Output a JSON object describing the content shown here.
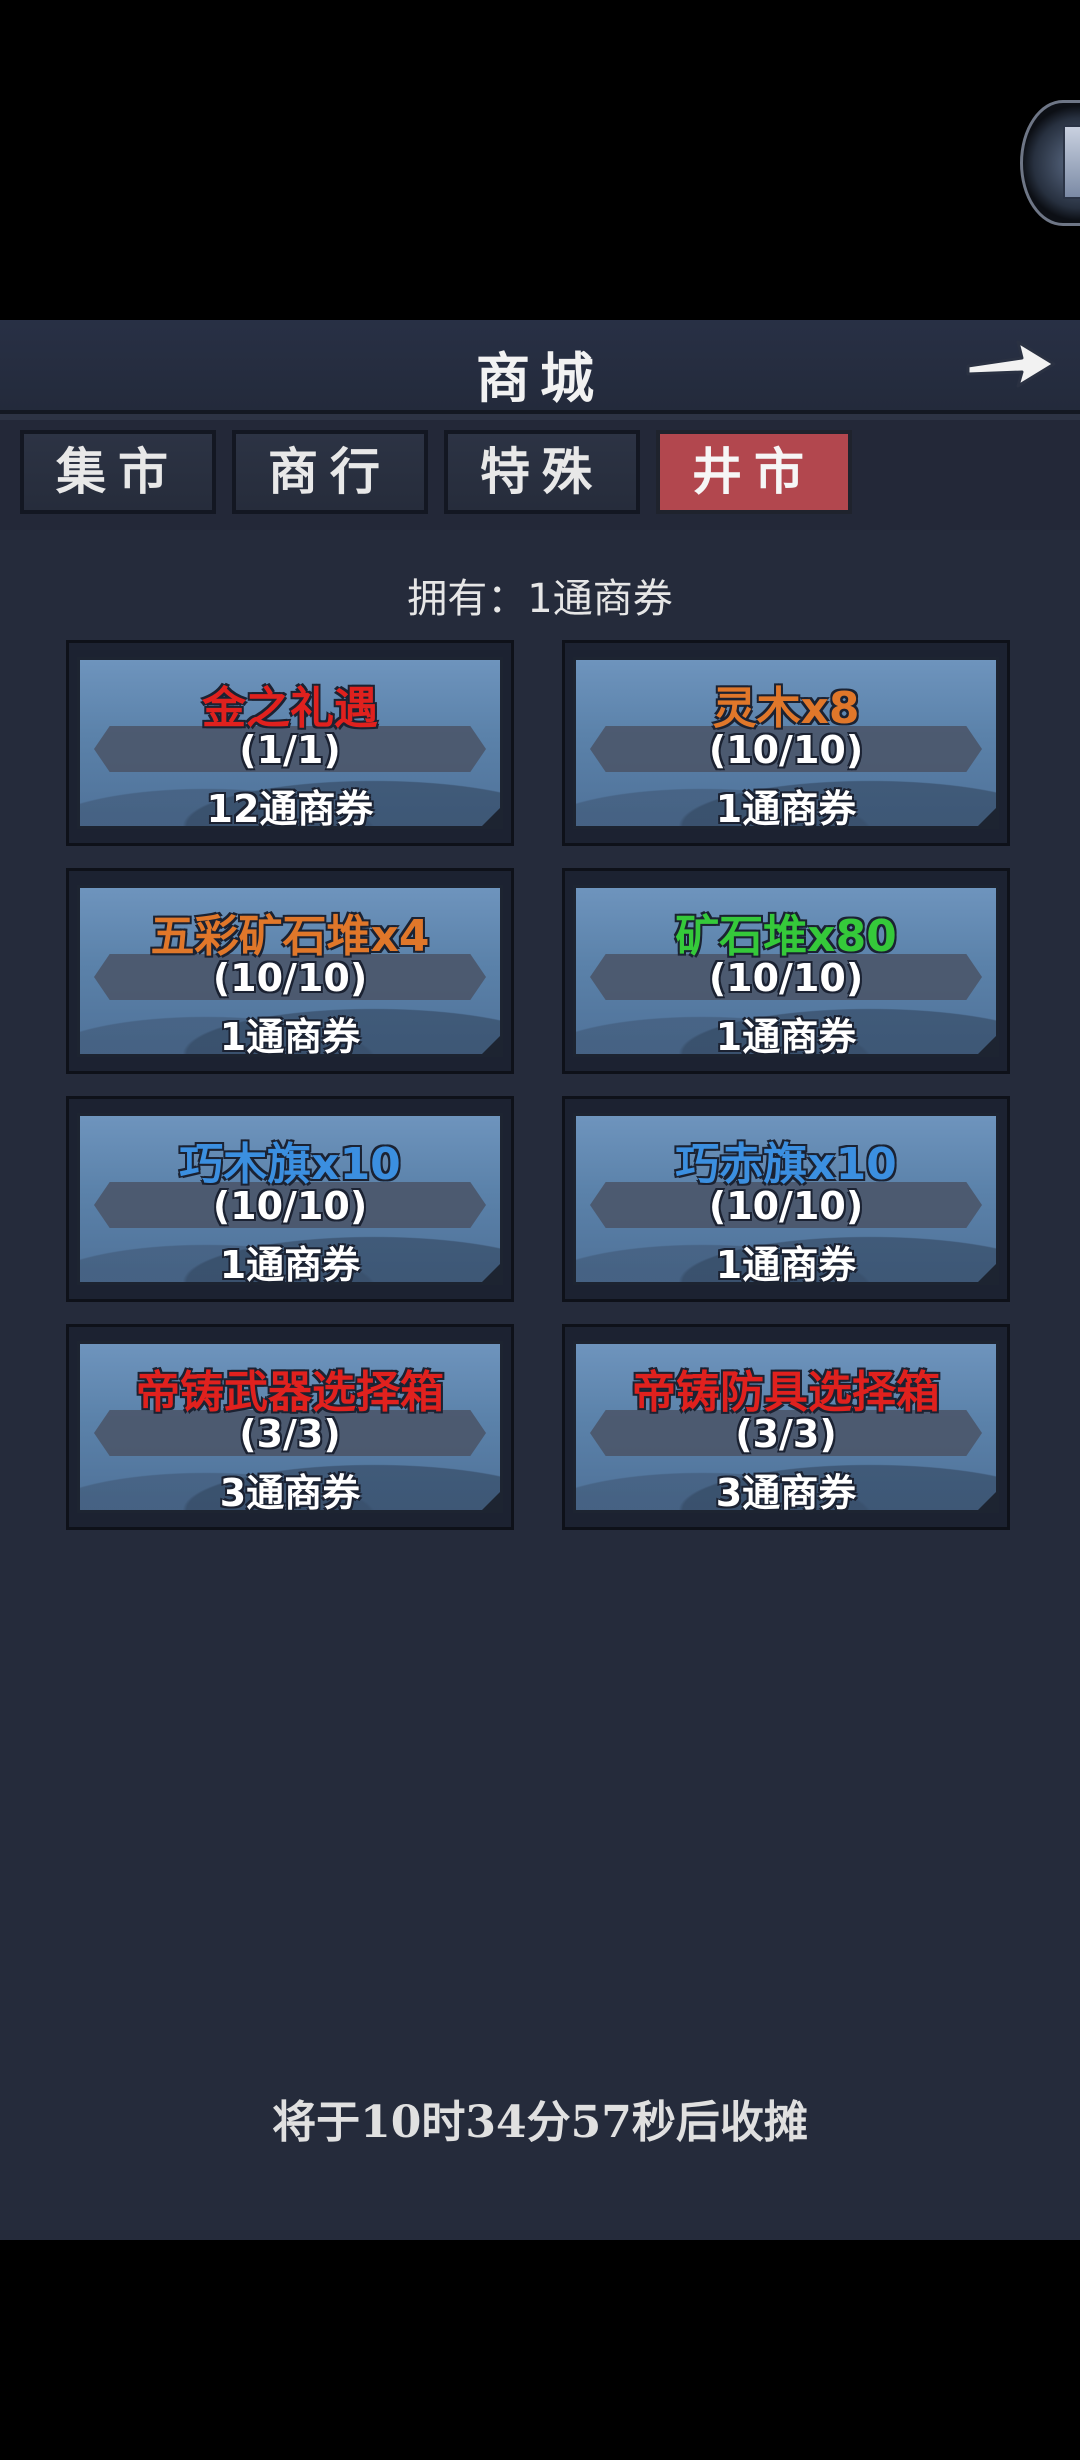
{
  "header": {
    "title": "商城"
  },
  "tabs": [
    {
      "label": "集市"
    },
    {
      "label": "商行"
    },
    {
      "label": "特殊"
    },
    {
      "label": "井市",
      "active": true
    }
  ],
  "owned_text": "拥有：1通商券",
  "items": [
    {
      "name": "金之礼遇",
      "limit": "(1/1)",
      "price": "12通商券",
      "color": "#e0211e"
    },
    {
      "name": "灵木x8",
      "limit": "(10/10)",
      "price": "1通商券",
      "color": "#e0772a"
    },
    {
      "name": "五彩矿石堆x4",
      "limit": "(10/10)",
      "price": "1通商券",
      "color": "#e0772a"
    },
    {
      "name": "矿石堆x80",
      "limit": "(10/10)",
      "price": "1通商券",
      "color": "#35c93a"
    },
    {
      "name": "巧木旗x10",
      "limit": "(10/10)",
      "price": "1通商券",
      "color": "#3b8fe0"
    },
    {
      "name": "巧赤旗x10",
      "limit": "(10/10)",
      "price": "1通商券",
      "color": "#3b8fe0"
    },
    {
      "name": "帝铸武器选择箱",
      "limit": "(3/3)",
      "price": "3通商券",
      "color": "#e0211e"
    },
    {
      "name": "帝铸防具选择箱",
      "limit": "(3/3)",
      "price": "3通商券",
      "color": "#e0211e"
    }
  ],
  "footer_text": "将于10时34分57秒后收摊",
  "colors": {
    "panel": "#232838",
    "active_tab": "#b2474e",
    "card_face": "#5b82aa"
  }
}
